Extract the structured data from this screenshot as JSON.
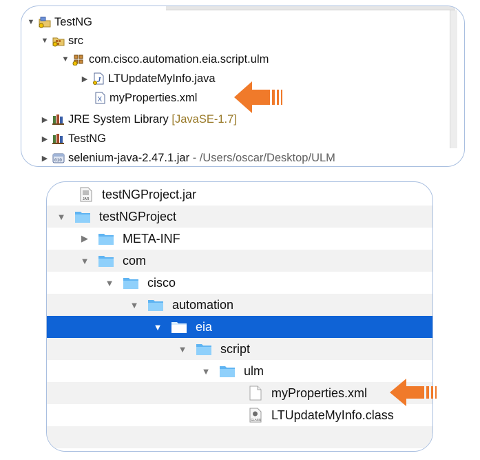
{
  "eclipse": {
    "rows": [
      {
        "label": "TestNG",
        "expanded": true,
        "icon": "java-project-icon"
      },
      {
        "label": "src",
        "expanded": true,
        "icon": "source-folder-icon"
      },
      {
        "label": "com.cisco.automation.eia.script.ulm",
        "expanded": true,
        "icon": "package-icon"
      },
      {
        "label": "LTUpdateMyInfo.java",
        "expanded": false,
        "icon": "java-file-icon"
      },
      {
        "label": "myProperties.xml",
        "icon": "xml-file-icon"
      },
      {
        "label": "JRE System Library",
        "decoration": "[JavaSE-1.7]",
        "expanded": false,
        "icon": "library-icon"
      },
      {
        "label": "TestNG",
        "expanded": false,
        "icon": "library-icon"
      },
      {
        "label": "selenium-java-2.47.1.jar",
        "decoration": "- /Users/oscar/Desktop/ULM",
        "expanded": false,
        "icon": "jar-icon"
      }
    ]
  },
  "finder": {
    "selected_color": "#0f63d6",
    "rows": [
      {
        "label": "testNGProject.jar",
        "type": "jar"
      },
      {
        "label": "testNGProject",
        "type": "folder",
        "expanded": true
      },
      {
        "label": "META-INF",
        "type": "folder",
        "expanded": false
      },
      {
        "label": "com",
        "type": "folder",
        "expanded": true
      },
      {
        "label": "cisco",
        "type": "folder",
        "expanded": true
      },
      {
        "label": "automation",
        "type": "folder",
        "expanded": true
      },
      {
        "label": "eia",
        "type": "folder",
        "expanded": true,
        "selected": true
      },
      {
        "label": "script",
        "type": "folder",
        "expanded": true
      },
      {
        "label": "ulm",
        "type": "folder",
        "expanded": true
      },
      {
        "label": "myProperties.xml",
        "type": "file"
      },
      {
        "label": "LTUpdateMyInfo.class",
        "type": "class"
      }
    ]
  },
  "glyphs": {
    "expanded": "▼",
    "collapsed": "▶"
  },
  "accent_color": "#f07a2a"
}
